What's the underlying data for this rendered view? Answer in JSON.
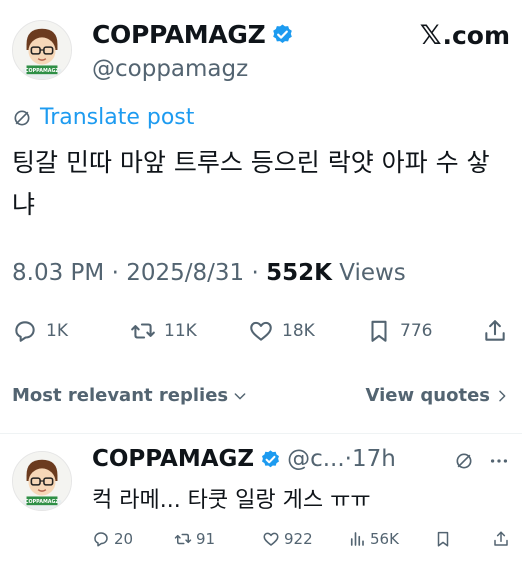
{
  "site": "com",
  "post": {
    "display_name": "COPPAMAGZ",
    "handle": "@coppamagz",
    "translate_label": "Translate post",
    "text": "팅갈 민따 마앞 트루스 등으린 락얏 아파 수 샇냐",
    "time": "8.03 PM",
    "date": "2025/8/31",
    "views_count": "552K",
    "views_label": "Views",
    "replies": "1K",
    "reposts": "11K",
    "likes": "18K",
    "bookmarks": "776"
  },
  "replies_bar": {
    "sort_label": "Most relevant replies",
    "quotes_label": "View quotes"
  },
  "reply": {
    "display_name": "COPPAMAGZ",
    "handle": "@c...",
    "time": "17h",
    "text": "컥 라메... 타쿳 일랑 게스 ㅠㅠ",
    "replies": "20",
    "reposts": "91",
    "likes": "922",
    "views": "56K"
  },
  "colors": {
    "accent": "#1d9bf0",
    "muted": "#536471",
    "text": "#0f1419"
  }
}
